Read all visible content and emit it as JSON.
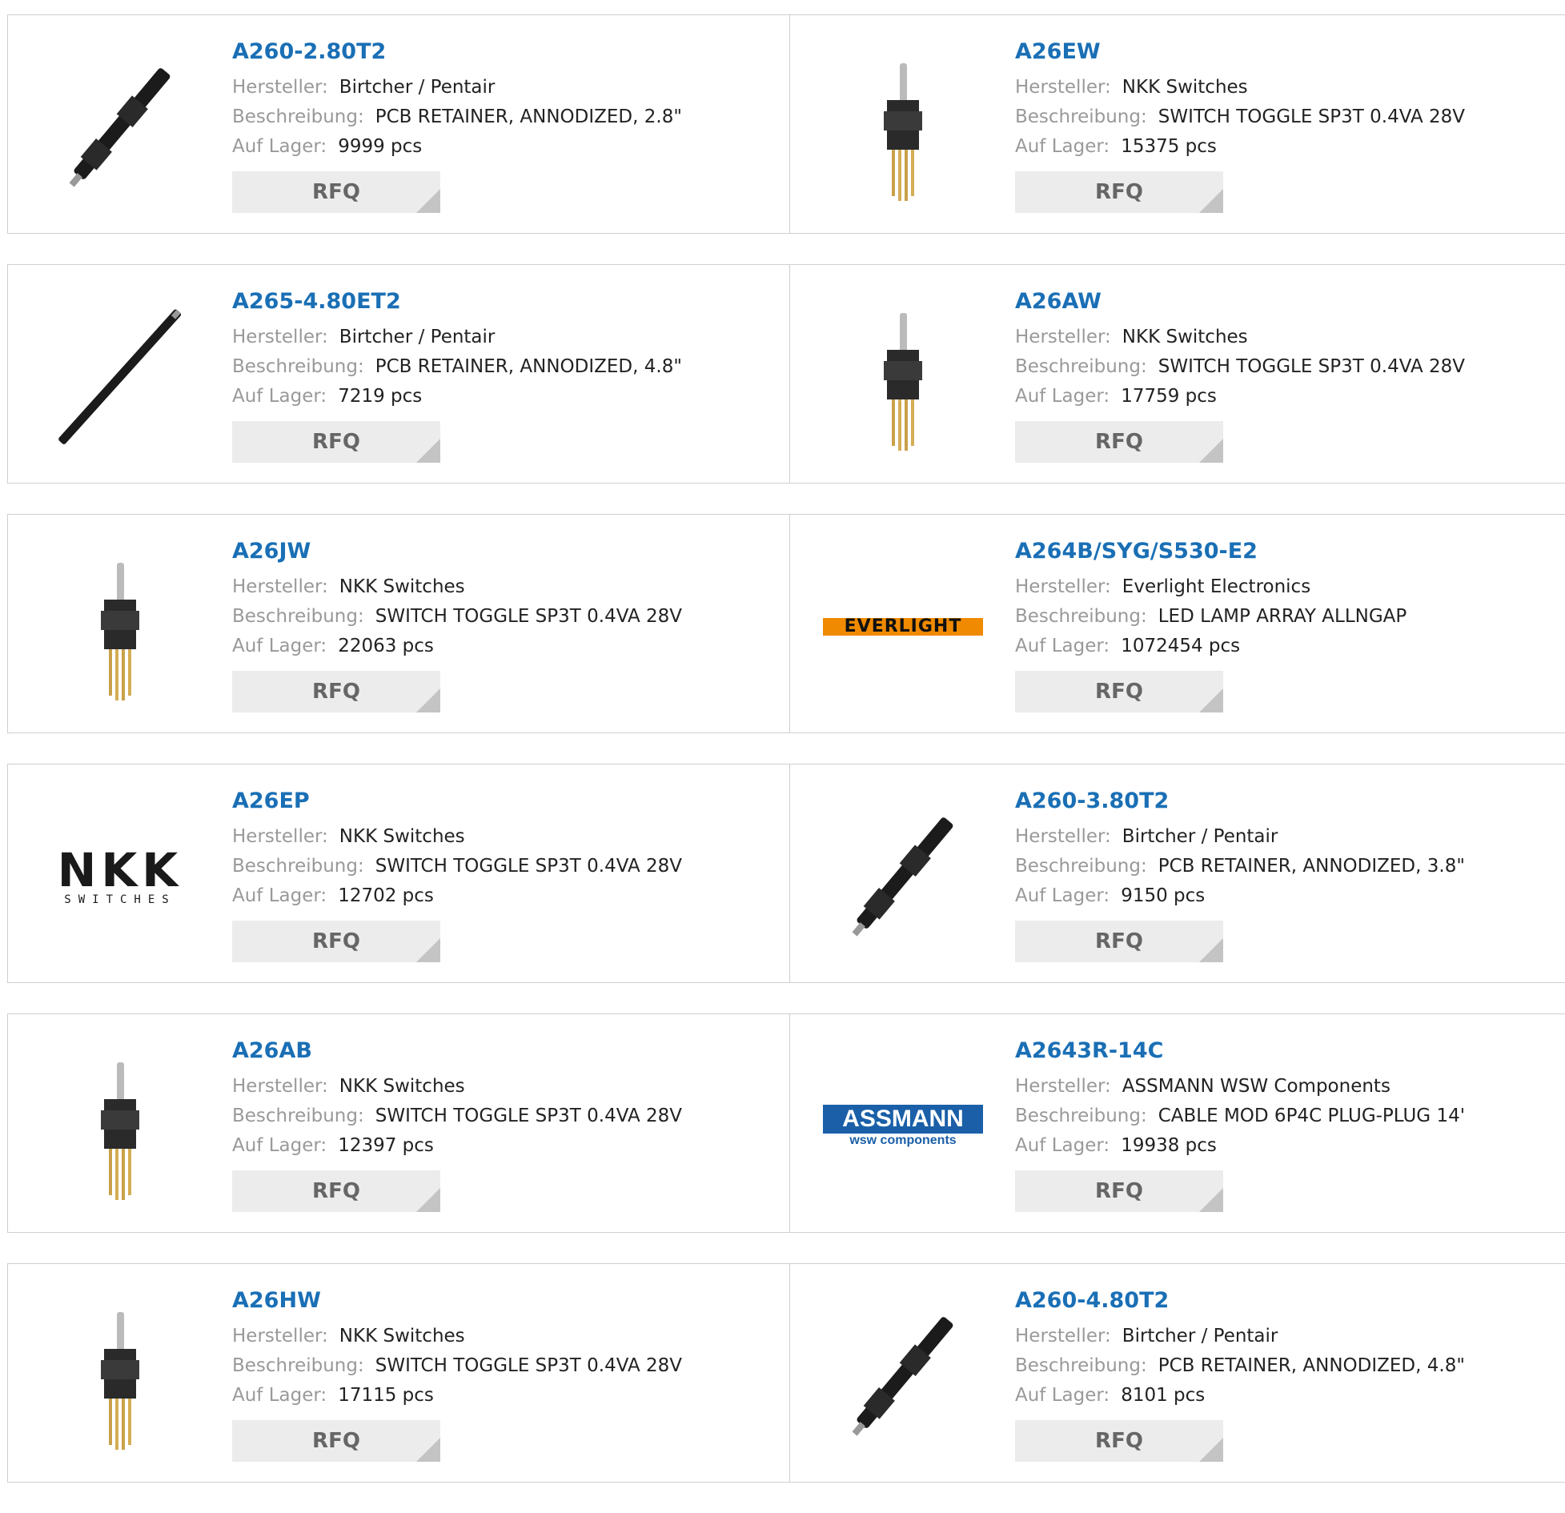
{
  "labels": {
    "manufacturer": "Hersteller:",
    "description": "Beschreibung:",
    "stock": "Auf Lager:",
    "rfq": "RFQ"
  },
  "products": [
    {
      "pn": "A260-2.80T2",
      "manufacturer": "Birtcher / Pentair",
      "description": "PCB RETAINER, ANNODIZED, 2.8\"",
      "stock": "9999 pcs",
      "image": "retainer-short-icon"
    },
    {
      "pn": "A26EW",
      "manufacturer": "NKK Switches",
      "description": "SWITCH TOGGLE SP3T 0.4VA 28V",
      "stock": "15375 pcs",
      "image": "toggle-switch-icon"
    },
    {
      "pn": "A265-4.80ET2",
      "manufacturer": "Birtcher / Pentair",
      "description": "PCB RETAINER, ANNODIZED, 4.8\"",
      "stock": "7219 pcs",
      "image": "retainer-long-icon"
    },
    {
      "pn": "A26AW",
      "manufacturer": "NKK Switches",
      "description": "SWITCH TOGGLE SP3T 0.4VA 28V",
      "stock": "17759 pcs",
      "image": "toggle-switch-icon"
    },
    {
      "pn": "A26JW",
      "manufacturer": "NKK Switches",
      "description": "SWITCH TOGGLE SP3T 0.4VA 28V",
      "stock": "22063 pcs",
      "image": "toggle-switch-icon"
    },
    {
      "pn": "A264B/SYG/S530-E2",
      "manufacturer": "Everlight Electronics",
      "description": "LED LAMP ARRAY ALLNGAP",
      "stock": "1072454 pcs",
      "image": "everlight-logo",
      "logo_text": "EVERLIGHT"
    },
    {
      "pn": "A26EP",
      "manufacturer": "NKK Switches",
      "description": "SWITCH TOGGLE SP3T 0.4VA 28V",
      "stock": "12702 pcs",
      "image": "nkk-logo",
      "logo_text": "NKK",
      "logo_sub": "SWITCHES"
    },
    {
      "pn": "A260-3.80T2",
      "manufacturer": "Birtcher / Pentair",
      "description": "PCB RETAINER, ANNODIZED, 3.8\"",
      "stock": "9150 pcs",
      "image": "retainer-short-icon"
    },
    {
      "pn": "A26AB",
      "manufacturer": "NKK Switches",
      "description": "SWITCH TOGGLE SP3T 0.4VA 28V",
      "stock": "12397 pcs",
      "image": "toggle-switch-icon"
    },
    {
      "pn": "A2643R-14C",
      "manufacturer": "ASSMANN WSW Components",
      "description": "CABLE MOD 6P4C PLUG-PLUG 14'",
      "stock": "19938 pcs",
      "image": "assmann-logo",
      "logo_text": "ASSMANN",
      "logo_sub": "wsw components"
    },
    {
      "pn": "A26HW",
      "manufacturer": "NKK Switches",
      "description": "SWITCH TOGGLE SP3T 0.4VA 28V",
      "stock": "17115 pcs",
      "image": "toggle-switch-icon"
    },
    {
      "pn": "A260-4.80T2",
      "manufacturer": "Birtcher / Pentair",
      "description": "PCB RETAINER, ANNODIZED, 4.8\"",
      "stock": "8101 pcs",
      "image": "retainer-short-icon"
    }
  ],
  "colors": {
    "link": "#1a6fb5",
    "label": "#999999",
    "button_bg": "#ececec",
    "everlight": "#f08a00",
    "assmann": "#1a5fa8"
  }
}
